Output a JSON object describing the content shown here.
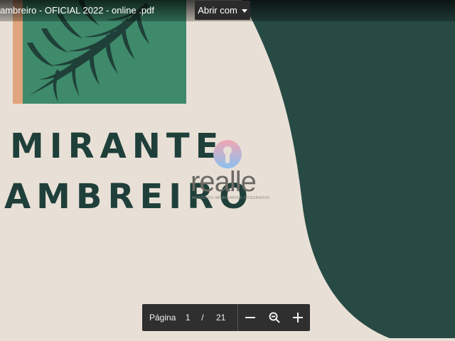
{
  "window": {
    "document_title": "ambreiro - OFICIAL 2022 - online .pdf"
  },
  "toolbar": {
    "open_with_label": "Abrir com",
    "open_with_icon": "chevron-down-icon"
  },
  "pdf_content": {
    "heading_line1": "MIRANTE",
    "heading_line2": "AMBREIRO",
    "watermark_word": "realle",
    "watermark_tagline": "NEGÓCIOS IMOBILIÁRIOS INTEGRADOS",
    "colors": {
      "page_background": "#e8e0d6",
      "dark_green": "#274a45",
      "mid_green": "#3e8a6b",
      "terracotta": "#e0a57c",
      "heading_text": "#1f3f3a",
      "logo_pink": "#f1a6b4",
      "logo_blue": "#8bc0ef"
    }
  },
  "pager": {
    "page_label": "Página",
    "current_page": "1",
    "separator": "/",
    "total_pages": "21",
    "zoom_out_icon": "minus-icon",
    "zoom_fit_icon": "magnifier-icon",
    "zoom_in_icon": "plus-icon"
  }
}
